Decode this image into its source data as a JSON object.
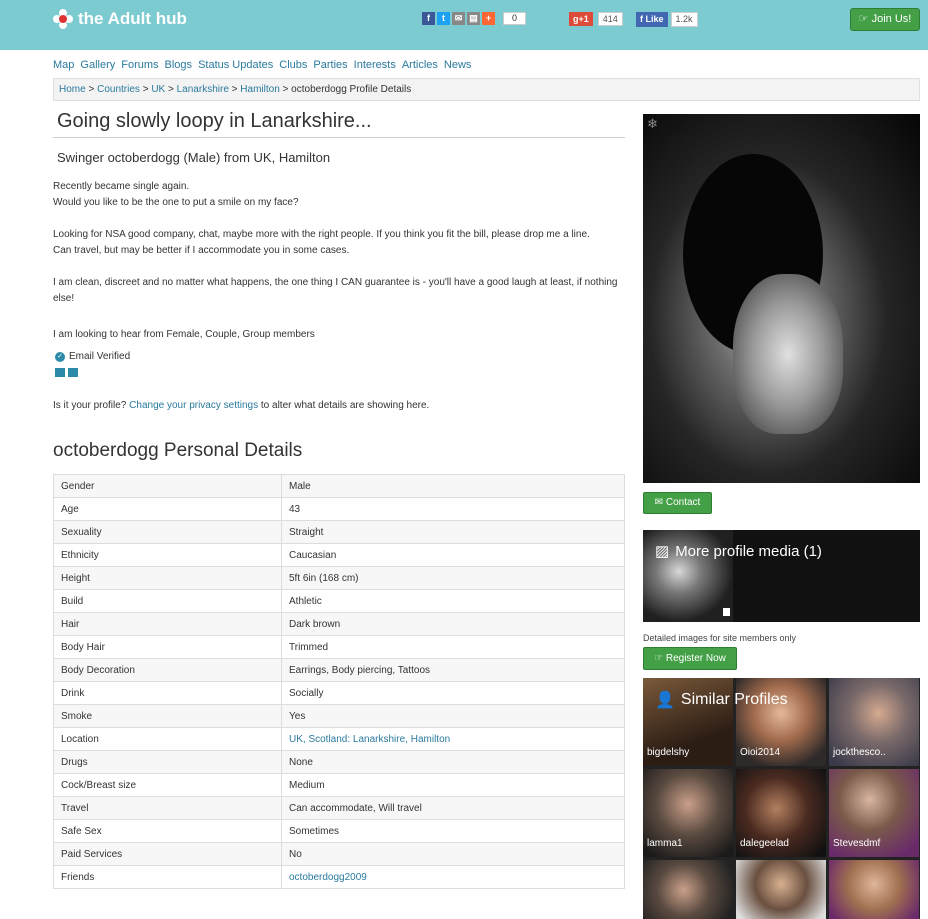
{
  "header": {
    "logo_text": "the Adult hub",
    "share_count": "0",
    "gplus_label": "g+1",
    "gplus_count": "414",
    "fb_like_label": "Like",
    "fb_like_count": "1.2k",
    "join_label": "Join Us!"
  },
  "nav": [
    "Map",
    "Gallery",
    "Forums",
    "Blogs",
    "Status Updates",
    "Clubs",
    "Parties",
    "Interests",
    "Articles",
    "News"
  ],
  "breadcrumb": {
    "items": [
      "Home",
      "Countries",
      "UK",
      "Lanarkshire",
      "Hamilton"
    ],
    "current": "octoberdogg Profile Details",
    "separator": ">"
  },
  "profile": {
    "headline": "Going slowly loopy in Lanarkshire...",
    "subtitle": "Swinger octoberdogg (Male) from UK, Hamilton",
    "bio": [
      "Recently became single again.",
      "Would you like to be the one to put a smile on my face?",
      "",
      "Looking for NSA good company, chat, maybe more with the right people. If you think you fit the bill, please drop me a line.",
      "Can travel, but may be better if I accommodate you in some cases.",
      "",
      "I am clean, discreet and no matter what happens, the one thing I CAN guarantee is - you'll have a good laugh at least, if nothing else!"
    ],
    "looking_for": "I am looking to hear from Female, Couple, Group members",
    "email_verified": "Email Verified",
    "privacy_prefix": "Is it your profile? ",
    "privacy_link": "Change your privacy settings",
    "privacy_suffix": " to alter what details are showing here."
  },
  "details": {
    "heading": "octoberdogg Personal Details",
    "rows": [
      {
        "key": "Gender",
        "value": "Male"
      },
      {
        "key": "Age",
        "value": "43"
      },
      {
        "key": "Sexuality",
        "value": "Straight"
      },
      {
        "key": "Ethnicity",
        "value": "Caucasian"
      },
      {
        "key": "Height",
        "value": "5ft 6in (168 cm)"
      },
      {
        "key": "Build",
        "value": "Athletic"
      },
      {
        "key": "Hair",
        "value": "Dark brown"
      },
      {
        "key": "Body Hair",
        "value": "Trimmed"
      },
      {
        "key": "Body Decoration",
        "value": "Earrings, Body piercing, Tattoos"
      },
      {
        "key": "Drink",
        "value": "Socially"
      },
      {
        "key": "Smoke",
        "value": "Yes"
      },
      {
        "key": "Location",
        "value": "UK, Scotland: Lanarkshire, Hamilton",
        "link": true
      },
      {
        "key": "Drugs",
        "value": "None"
      },
      {
        "key": "Cock/Breast size",
        "value": "Medium"
      },
      {
        "key": "Travel",
        "value": "Can accommodate, Will travel"
      },
      {
        "key": "Safe Sex",
        "value": "Sometimes"
      },
      {
        "key": "Paid Services",
        "value": "No"
      },
      {
        "key": "Friends",
        "value": "octoberdogg2009",
        "link": true
      }
    ]
  },
  "sidebar": {
    "contact_label": "Contact",
    "media_label": "More profile media (1)",
    "members_note": "Detailed images for site members only",
    "register_label": "Register Now",
    "similar_heading": "Similar Profiles",
    "similar_profiles": [
      "bigdelshy",
      "Oioi2014",
      "jockthesco..",
      "lamma1",
      "dalegeelad",
      "Stevesdmf",
      "",
      "",
      ""
    ]
  },
  "colors": {
    "header_bg": "#7ccbd0",
    "button_green": "#43a047",
    "link_blue": "#2a7a9e"
  }
}
